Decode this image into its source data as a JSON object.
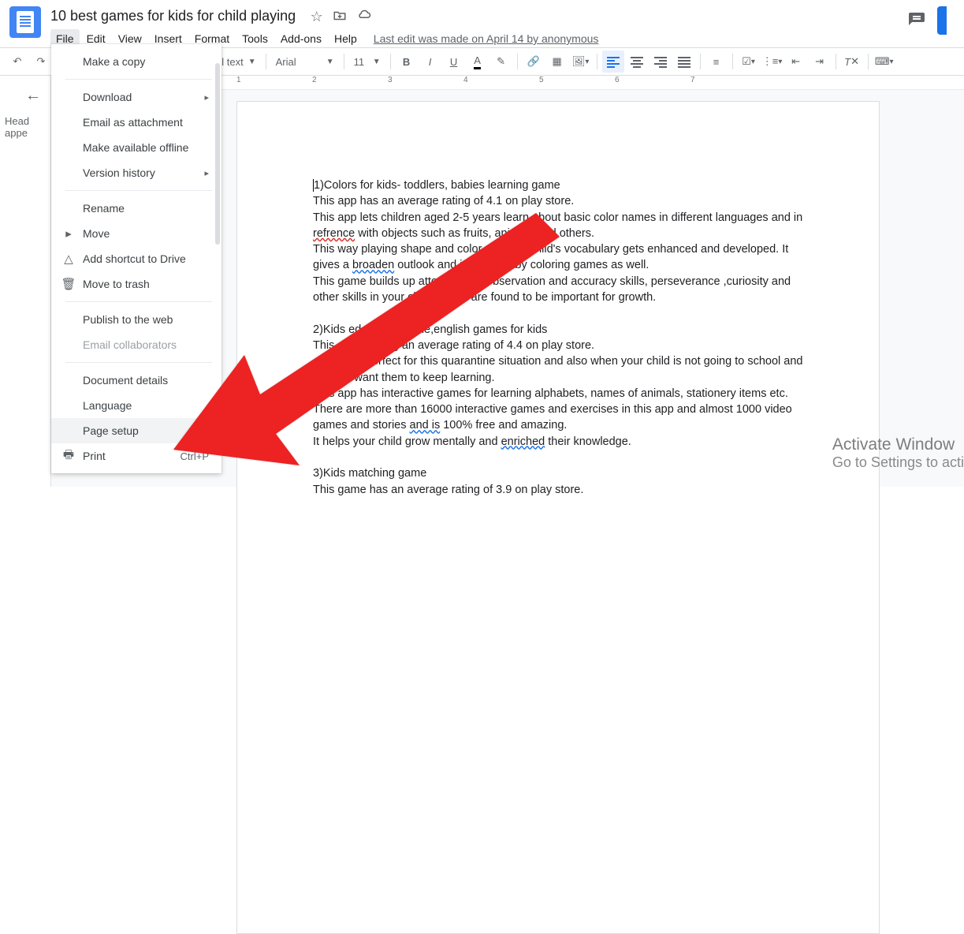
{
  "doc_title": "10 best games for kids for child playing",
  "menu": {
    "file": "File",
    "edit": "Edit",
    "view": "View",
    "insert": "Insert",
    "format": "Format",
    "tools": "Tools",
    "addons": "Add-ons",
    "help": "Help"
  },
  "last_edit": "Last edit was made on April 14 by anonymous",
  "toolbar": {
    "style_suffix": "al text",
    "font": "Arial",
    "size": "11"
  },
  "outline": {
    "line1": "Head",
    "line2": "appe"
  },
  "ruler_numbers": [
    "1",
    "2",
    "3",
    "4",
    "5",
    "6",
    "7"
  ],
  "dropdown": {
    "make_copy": "Make a copy",
    "download": "Download",
    "email_attach": "Email as attachment",
    "offline": "Make available offline",
    "version": "Version history",
    "rename": "Rename",
    "move": "Move",
    "shortcut": "Add shortcut to Drive",
    "trash": "Move to trash",
    "publish": "Publish to the web",
    "email_collab": "Email collaborators",
    "details": "Document details",
    "language": "Language",
    "page_setup": "Page setup",
    "print": "Print",
    "print_short": "Ctrl+P"
  },
  "body": {
    "p1a": "1)Colors for kids- toddlers, babies learning game",
    "p1b": "This app has an average rating of 4.1 on play store.",
    "p1c_a": "This app lets children aged 2-5 years learn about basic color names in different languages and in ",
    "p1c_err": "refrence",
    "p1c_b": " with objects such as fruits, animals and others.",
    "p1d_a": "This way playing shape and color gam",
    "p1d_b": " child's vocabulary gets enhanced and developed. It gives a ",
    "p1d_err": "broaden",
    "p1d_c": " outlook and it in",
    "p1d_d": "s baby coloring games as well.",
    "p1e_a": "This game builds up attenti",
    "p1e_b": "ss, observation and accuracy skills, perseverance ,curiosity and other skills in your ch",
    "p1e_c": "ich all are found to be important for growth.",
    "p2a_a": "2)Kids ed",
    "p2a_b": "nal game,english games for kids",
    "p2b_a": "This",
    "p2b_b": "is having an average rating of 4.4 on play store.",
    "p2c_a": "app is perfect for this quarantine situation and also when your child is not going to school and you still want them to keep learning.",
    "p2d": "This app has interactive games for learning alphabets, names of animals, stationery items etc.",
    "p2e_a": "There are more than 16000 interactive games and exercises in this app and almost 1000 video games and stories ",
    "p2e_err": "and is",
    "p2e_b": " 100% free and amazing.",
    "p2f_a": "It helps your child grow mentally and ",
    "p2f_err": "enriched",
    "p2f_b": " their knowledge.",
    "p3a": "3)Kids matching game",
    "p3b": "This game has an average rating of 3.9 on play store."
  },
  "watermark": {
    "title": "Activate Window",
    "sub": "Go to Settings to acti"
  }
}
